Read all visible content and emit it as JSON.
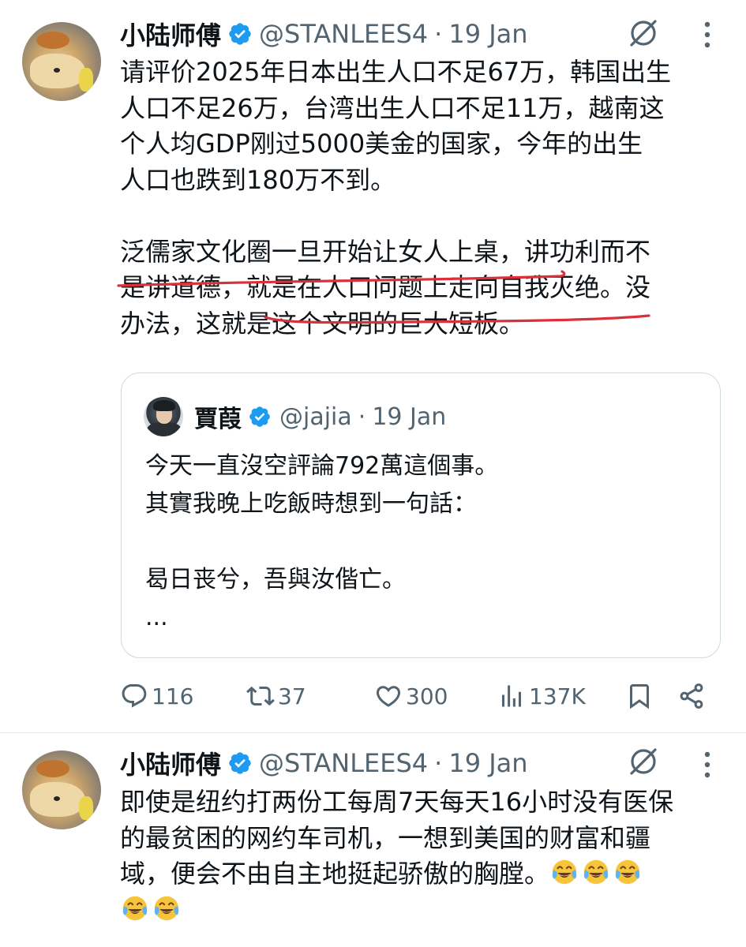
{
  "tweets": [
    {
      "author": {
        "name": "小陆师傅",
        "handle": "@STANLEES4",
        "separator": "·",
        "date": "19 Jan"
      },
      "paragraph1": "请评价2025年日本出生人口不足67万，韩国出生\n人口不足26万，台湾出生人口不足11万，越南这\n个人均GDP刚过5000美金的国家，今年的出生\n人口也跌到180万不到。",
      "paragraph2": {
        "line1_underlined": "泛儒家文化圈一旦开始让女人上桌，",
        "line1_rest": "讲功利而不",
        "line2_start": "是讲道德，",
        "line2_underlined": "就是在人口问题上走向自我灭绝。",
        "line2_rest": "没",
        "line3": "办法，这就是这个文明的巨大短板。"
      },
      "quote": {
        "author": {
          "name": "賈葭",
          "handle": "@jajia",
          "separator": "·",
          "date": "19 Jan"
        },
        "text": "今天一直沒空評論792萬這個事。\n其實我晚上吃飯時想到一句話：\n\n曷日丧兮，吾與汝偕亡。\n..."
      },
      "actions": {
        "replies": "116",
        "retweets": "37",
        "likes": "300",
        "views": "137K"
      }
    },
    {
      "author": {
        "name": "小陆师傅",
        "handle": "@STANLEES4",
        "separator": "·",
        "date": "19 Jan"
      },
      "text_lines": [
        "即使是纽约打两份工每周7天每天16小时没有医保",
        "的最贫困的网约车司机，一想到美国的财富和疆",
        "域，便会不由自主地挺起骄傲的胸膛。"
      ],
      "emoji": "face-with-tears-of-joy",
      "emoji_count_line3": 3,
      "emoji_count_line4": 2
    }
  ],
  "colors": {
    "text": "#0f1419",
    "secondary": "#536471",
    "verified": "#1d9bf0",
    "annotation": "#d9303a",
    "border": "#cfd9de"
  }
}
